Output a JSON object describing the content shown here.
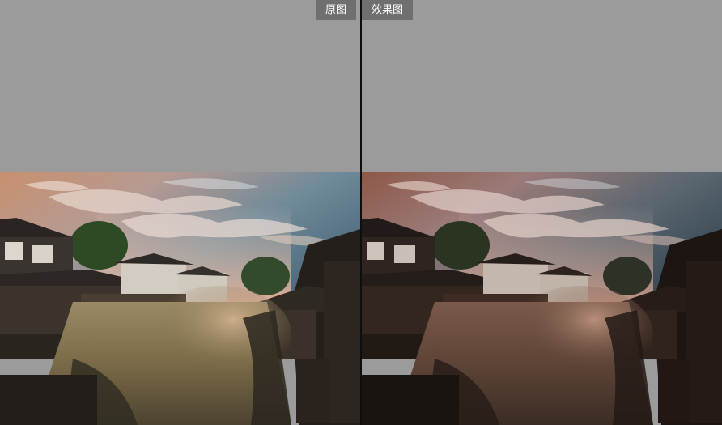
{
  "labels": {
    "original": "原图",
    "effect": "效果图"
  },
  "colors": {
    "background": "#9b9b9b",
    "divider": "#0e0e0e",
    "label_bg": "#6f6f6f"
  },
  "images": {
    "original": "photo-original",
    "effect": "photo-effect"
  }
}
